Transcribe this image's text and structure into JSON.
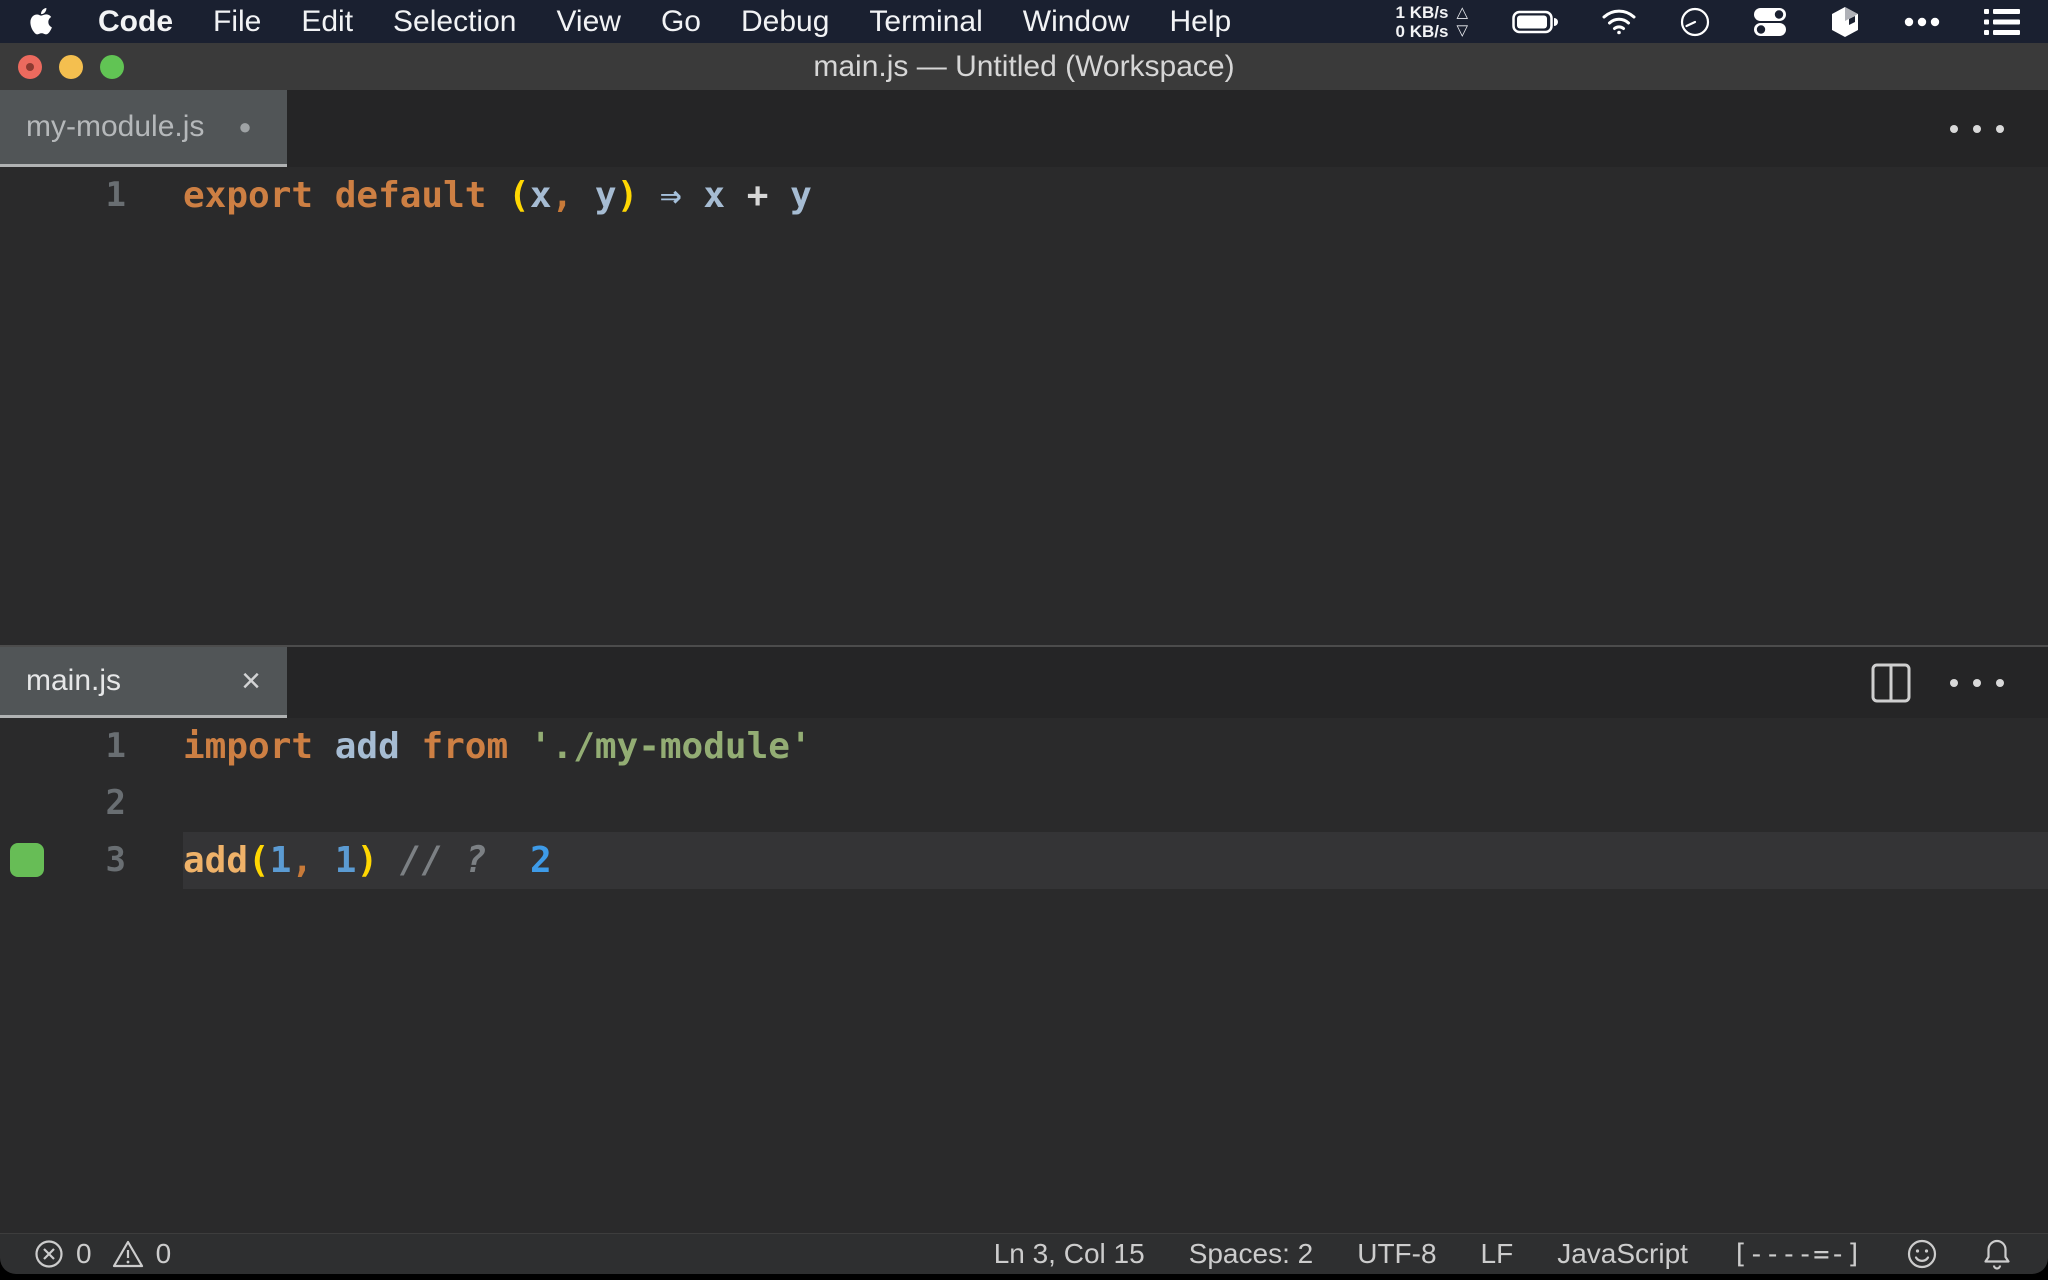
{
  "menu_bar": {
    "app_menu": "Code",
    "items": [
      "File",
      "Edit",
      "Selection",
      "View",
      "Go",
      "Debug",
      "Terminal",
      "Window",
      "Help"
    ],
    "network_up": "1 KB/s",
    "network_down": "0 KB/s",
    "up_arrow": "△",
    "down_arrow": "▽"
  },
  "title_bar": {
    "title": "main.js — Untitled (Workspace)"
  },
  "top_pane": {
    "tab_label": "my-module.js",
    "modified_dot": "●",
    "lines": [
      {
        "num": "1",
        "tokens": [
          [
            "export",
            "kw"
          ],
          [
            " ",
            ""
          ],
          [
            "default",
            "kw"
          ],
          [
            " ",
            ""
          ],
          [
            "(",
            "paren"
          ],
          [
            "x",
            "var"
          ],
          [
            ",",
            "comma"
          ],
          [
            " ",
            ""
          ],
          [
            "y",
            "var"
          ],
          [
            ")",
            "paren"
          ],
          [
            " ",
            ""
          ],
          [
            "⇒",
            "arrow"
          ],
          [
            " ",
            ""
          ],
          [
            "x",
            "var"
          ],
          [
            " ",
            ""
          ],
          [
            "+",
            "op"
          ],
          [
            " ",
            ""
          ],
          [
            "y",
            "var"
          ]
        ]
      }
    ]
  },
  "bottom_pane": {
    "tab_label": "main.js",
    "close_glyph": "×",
    "lines": [
      {
        "num": "1",
        "tokens": [
          [
            "import",
            "kw"
          ],
          [
            " ",
            ""
          ],
          [
            "add",
            "var"
          ],
          [
            " ",
            ""
          ],
          [
            "from",
            "kw"
          ],
          [
            " ",
            ""
          ],
          [
            "'./my-module'",
            "str"
          ]
        ]
      },
      {
        "num": "2",
        "tokens": []
      },
      {
        "num": "3",
        "tokens": [
          [
            "add",
            "fn"
          ],
          [
            "(",
            "paren"
          ],
          [
            "1",
            "num"
          ],
          [
            ",",
            "comma"
          ],
          [
            " ",
            ""
          ],
          [
            "1",
            "num"
          ],
          [
            ")",
            "paren"
          ],
          [
            " ",
            ""
          ],
          [
            "//",
            "comment"
          ],
          [
            " ",
            ""
          ],
          [
            "?",
            "comment"
          ],
          [
            "  ",
            ""
          ],
          [
            "2",
            "inline"
          ]
        ]
      }
    ]
  },
  "status_bar": {
    "errors": "0",
    "warnings": "0",
    "cursor": "Ln 3, Col 15",
    "indent": "Spaces: 2",
    "encoding": "UTF-8",
    "eol": "LF",
    "language": "JavaScript",
    "quokka_indicator": "[----=-]"
  },
  "editor_theme": {
    "background": "#2a2a2b",
    "current_line": "#343436",
    "coverage_green": "#67bd56",
    "token_colors": {
      "kw": "#cd7f43",
      "fn": "#efb269",
      "paren": "#ffd702",
      "var": "#a6bcd3",
      "comma": "#c87a39",
      "op": "#d6d6d6",
      "arrow": "#a6c1dc",
      "str": "#93ad74",
      "num": "#5b9bd3",
      "comment": "#7c8084",
      "inline": "#3e9be8"
    }
  }
}
